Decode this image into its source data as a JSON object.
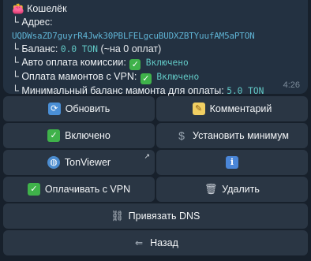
{
  "message": {
    "title_icon": "wallet-icon",
    "title": "Кошелёк",
    "address_label": "└ Адрес:",
    "address": "UQDWsaZD7guyrR4Jwk30PBLFELgcuBUDXZBTYuufAM5aPTON",
    "balance_label": "└ Баланс:",
    "balance_value": "0.0 TON",
    "balance_note": "(~на 0 оплат)",
    "auto_pay_label": "└ Авто оплата комиссии:",
    "auto_pay_value": "Включено",
    "vpn_pay_label": "└ Оплата мамонтов с VPN:",
    "vpn_pay_value": "Включено",
    "min_balance_label": "└ Минимальный баланс мамонта для оплаты:",
    "min_balance_value": "5.0 TON",
    "time": "4:26"
  },
  "keyboard": {
    "refresh": "Обновить",
    "comment": "Комментарий",
    "enabled": "Включено",
    "set_min": "Установить минимум",
    "tonviewer": "TonViewer",
    "info_symbol": "i",
    "pay_vpn": "Оплачивать с VPN",
    "delete": "Удалить",
    "link_dns": "Привязать DNS",
    "back": "Назад"
  },
  "icons": {
    "refresh": "refresh-icon",
    "comment": "memo-icon",
    "check": "check-mark-icon",
    "dollar": "dollar-icon",
    "globe": "globe-icon",
    "info": "info-icon",
    "trash": "wastebasket-icon",
    "chain": "chain-link-icon",
    "back": "back-arrow-icon",
    "external": "external-link-icon"
  },
  "colors": {
    "background": "#17202b",
    "bubble": "#233141",
    "button": "#2a3644",
    "mono_value": "#62c9c6",
    "enabled_green": "#3fb24a"
  }
}
